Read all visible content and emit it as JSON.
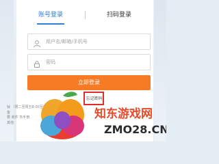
{
  "tabs": {
    "account_login": "账号登录",
    "qr_login": "扫码登录"
  },
  "form": {
    "username_placeholder": "用户名/邮箱/手机号",
    "password_placeholder": "密码",
    "login_button": "立即登录",
    "forgot_password": "忘记密码"
  },
  "notice": {
    "line1": "钛",
    "line2": "客",
    "line3": "要",
    "line4": "其他",
    "fragment1": "（周二至周五8:00至23:30）或",
    "fragment2": "收件",
    "fragment3": "务手册"
  },
  "watermark": {
    "brand": "知东游戏网",
    "url": "ZMO28.CN"
  },
  "colors": {
    "accent_blue": "#2f7fd6",
    "login_orange": "#f77a25",
    "highlight_red": "#e02b2b"
  }
}
